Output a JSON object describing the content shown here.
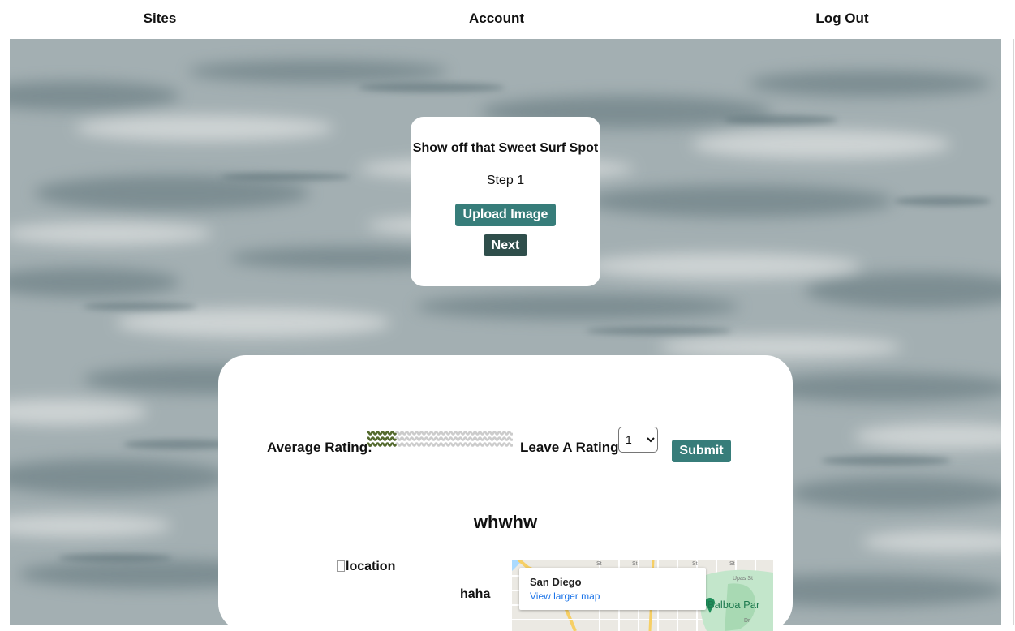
{
  "nav": {
    "sites": "Sites",
    "account": "Account",
    "logout": "Log Out"
  },
  "upload_card": {
    "title": "Show off that Sweet Surf Spot",
    "step": "Step 1",
    "upload_button": "Upload Image",
    "next_button": "Next"
  },
  "site": {
    "average_rating_label": "Average Rating:",
    "average_rating": 1,
    "rating_max": 5,
    "leave_rating_label": "Leave A Rating",
    "selected_rating": "1",
    "submit_button": "Submit",
    "name": "whwhw",
    "image_alt": "location",
    "description": "haha"
  },
  "map": {
    "place": "San Diego",
    "link": "View larger map",
    "poi": "Balboa Par",
    "streets": [
      "Upas St",
      "St",
      "St",
      "St",
      "St",
      "Dr"
    ]
  },
  "colors": {
    "primary_button": "#377d7a",
    "next_button": "#2f4e4b",
    "wave_filled": "#556b2f",
    "wave_empty": "#cccccc"
  }
}
